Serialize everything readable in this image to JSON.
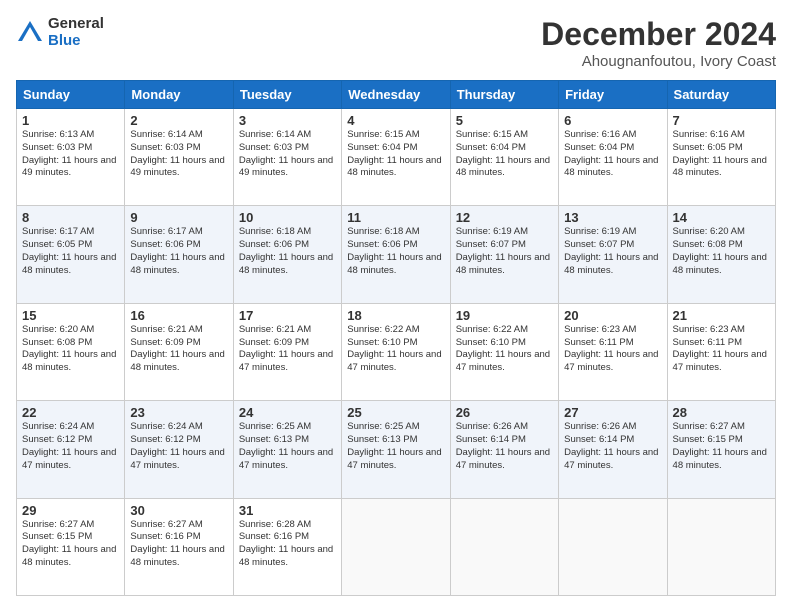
{
  "logo": {
    "general": "General",
    "blue": "Blue"
  },
  "header": {
    "title": "December 2024",
    "subtitle": "Ahougnanfoutou, Ivory Coast"
  },
  "calendar": {
    "days_of_week": [
      "Sunday",
      "Monday",
      "Tuesday",
      "Wednesday",
      "Thursday",
      "Friday",
      "Saturday"
    ],
    "weeks": [
      [
        null,
        null,
        null,
        null,
        null,
        null,
        {
          "day": "1",
          "sunrise": "Sunrise: 6:13 AM",
          "sunset": "Sunset: 6:03 PM",
          "daylight": "Daylight: 11 hours and 49 minutes."
        },
        {
          "day": "2",
          "sunrise": "Sunrise: 6:14 AM",
          "sunset": "Sunset: 6:03 PM",
          "daylight": "Daylight: 11 hours and 49 minutes."
        },
        {
          "day": "3",
          "sunrise": "Sunrise: 6:14 AM",
          "sunset": "Sunset: 6:03 PM",
          "daylight": "Daylight: 11 hours and 49 minutes."
        },
        {
          "day": "4",
          "sunrise": "Sunrise: 6:15 AM",
          "sunset": "Sunset: 6:04 PM",
          "daylight": "Daylight: 11 hours and 48 minutes."
        },
        {
          "day": "5",
          "sunrise": "Sunrise: 6:15 AM",
          "sunset": "Sunset: 6:04 PM",
          "daylight": "Daylight: 11 hours and 48 minutes."
        },
        {
          "day": "6",
          "sunrise": "Sunrise: 6:16 AM",
          "sunset": "Sunset: 6:04 PM",
          "daylight": "Daylight: 11 hours and 48 minutes."
        },
        {
          "day": "7",
          "sunrise": "Sunrise: 6:16 AM",
          "sunset": "Sunset: 6:05 PM",
          "daylight": "Daylight: 11 hours and 48 minutes."
        }
      ],
      [
        {
          "day": "8",
          "sunrise": "Sunrise: 6:17 AM",
          "sunset": "Sunset: 6:05 PM",
          "daylight": "Daylight: 11 hours and 48 minutes."
        },
        {
          "day": "9",
          "sunrise": "Sunrise: 6:17 AM",
          "sunset": "Sunset: 6:06 PM",
          "daylight": "Daylight: 11 hours and 48 minutes."
        },
        {
          "day": "10",
          "sunrise": "Sunrise: 6:18 AM",
          "sunset": "Sunset: 6:06 PM",
          "daylight": "Daylight: 11 hours and 48 minutes."
        },
        {
          "day": "11",
          "sunrise": "Sunrise: 6:18 AM",
          "sunset": "Sunset: 6:06 PM",
          "daylight": "Daylight: 11 hours and 48 minutes."
        },
        {
          "day": "12",
          "sunrise": "Sunrise: 6:19 AM",
          "sunset": "Sunset: 6:07 PM",
          "daylight": "Daylight: 11 hours and 48 minutes."
        },
        {
          "day": "13",
          "sunrise": "Sunrise: 6:19 AM",
          "sunset": "Sunset: 6:07 PM",
          "daylight": "Daylight: 11 hours and 48 minutes."
        },
        {
          "day": "14",
          "sunrise": "Sunrise: 6:20 AM",
          "sunset": "Sunset: 6:08 PM",
          "daylight": "Daylight: 11 hours and 48 minutes."
        }
      ],
      [
        {
          "day": "15",
          "sunrise": "Sunrise: 6:20 AM",
          "sunset": "Sunset: 6:08 PM",
          "daylight": "Daylight: 11 hours and 48 minutes."
        },
        {
          "day": "16",
          "sunrise": "Sunrise: 6:21 AM",
          "sunset": "Sunset: 6:09 PM",
          "daylight": "Daylight: 11 hours and 48 minutes."
        },
        {
          "day": "17",
          "sunrise": "Sunrise: 6:21 AM",
          "sunset": "Sunset: 6:09 PM",
          "daylight": "Daylight: 11 hours and 47 minutes."
        },
        {
          "day": "18",
          "sunrise": "Sunrise: 6:22 AM",
          "sunset": "Sunset: 6:10 PM",
          "daylight": "Daylight: 11 hours and 47 minutes."
        },
        {
          "day": "19",
          "sunrise": "Sunrise: 6:22 AM",
          "sunset": "Sunset: 6:10 PM",
          "daylight": "Daylight: 11 hours and 47 minutes."
        },
        {
          "day": "20",
          "sunrise": "Sunrise: 6:23 AM",
          "sunset": "Sunset: 6:11 PM",
          "daylight": "Daylight: 11 hours and 47 minutes."
        },
        {
          "day": "21",
          "sunrise": "Sunrise: 6:23 AM",
          "sunset": "Sunset: 6:11 PM",
          "daylight": "Daylight: 11 hours and 47 minutes."
        }
      ],
      [
        {
          "day": "22",
          "sunrise": "Sunrise: 6:24 AM",
          "sunset": "Sunset: 6:12 PM",
          "daylight": "Daylight: 11 hours and 47 minutes."
        },
        {
          "day": "23",
          "sunrise": "Sunrise: 6:24 AM",
          "sunset": "Sunset: 6:12 PM",
          "daylight": "Daylight: 11 hours and 47 minutes."
        },
        {
          "day": "24",
          "sunrise": "Sunrise: 6:25 AM",
          "sunset": "Sunset: 6:13 PM",
          "daylight": "Daylight: 11 hours and 47 minutes."
        },
        {
          "day": "25",
          "sunrise": "Sunrise: 6:25 AM",
          "sunset": "Sunset: 6:13 PM",
          "daylight": "Daylight: 11 hours and 47 minutes."
        },
        {
          "day": "26",
          "sunrise": "Sunrise: 6:26 AM",
          "sunset": "Sunset: 6:14 PM",
          "daylight": "Daylight: 11 hours and 47 minutes."
        },
        {
          "day": "27",
          "sunrise": "Sunrise: 6:26 AM",
          "sunset": "Sunset: 6:14 PM",
          "daylight": "Daylight: 11 hours and 47 minutes."
        },
        {
          "day": "28",
          "sunrise": "Sunrise: 6:27 AM",
          "sunset": "Sunset: 6:15 PM",
          "daylight": "Daylight: 11 hours and 48 minutes."
        }
      ],
      [
        {
          "day": "29",
          "sunrise": "Sunrise: 6:27 AM",
          "sunset": "Sunset: 6:15 PM",
          "daylight": "Daylight: 11 hours and 48 minutes."
        },
        {
          "day": "30",
          "sunrise": "Sunrise: 6:27 AM",
          "sunset": "Sunset: 6:16 PM",
          "daylight": "Daylight: 11 hours and 48 minutes."
        },
        {
          "day": "31",
          "sunrise": "Sunrise: 6:28 AM",
          "sunset": "Sunset: 6:16 PM",
          "daylight": "Daylight: 11 hours and 48 minutes."
        },
        null,
        null,
        null,
        null
      ]
    ]
  }
}
